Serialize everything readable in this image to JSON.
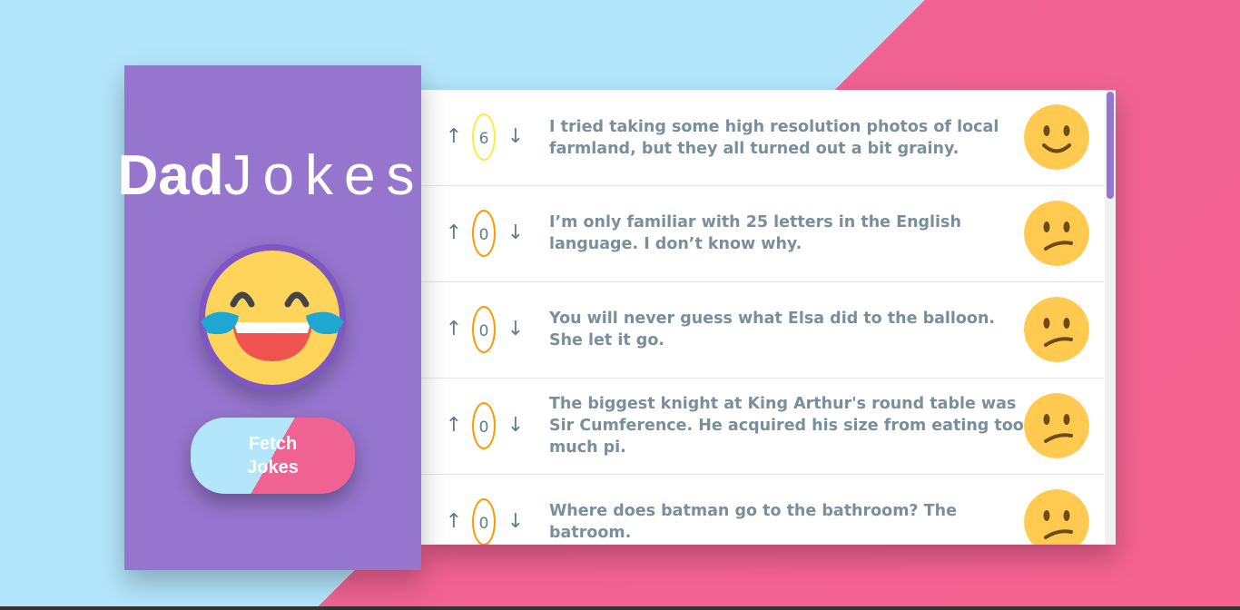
{
  "app": {
    "title_bold": "Dad",
    "title_light": "Jokes",
    "fetch_button_label": "Fetch Jokes"
  },
  "jokes": [
    {
      "score": "6",
      "text": "I tried taking some high resolution photos of local farmland, but they all turned out a bit grainy.",
      "ring_color": "#ffeb3b",
      "face": "smile"
    },
    {
      "score": "0",
      "text": "I’m only familiar with 25 letters in the English language. I don’t know why.",
      "ring_color": "#ff9800",
      "face": "confused"
    },
    {
      "score": "0",
      "text": "You will never guess what Elsa did to the balloon. She let it go.",
      "ring_color": "#ff9800",
      "face": "confused"
    },
    {
      "score": "0",
      "text": "The biggest knight at King Arthur's round table was Sir Cumference. He acquired his size from eating too much pi.",
      "ring_color": "#ff9800",
      "face": "confused"
    },
    {
      "score": "0",
      "text": "Where does batman go to the bathroom? The batroom.",
      "ring_color": "#ff9800",
      "face": "confused"
    }
  ],
  "icons": {
    "up": "arrow-up-icon",
    "down": "arrow-down-icon",
    "laugh": "laughing-tears-emoji",
    "smile": "smile-emoji",
    "confused": "confused-emoji"
  },
  "colors": {
    "background_left": "#b3e5fb",
    "background_right": "#f06292",
    "sidebar": "#9575cd",
    "text": "#78909c",
    "emoji_yellow": "#ffca4f"
  }
}
